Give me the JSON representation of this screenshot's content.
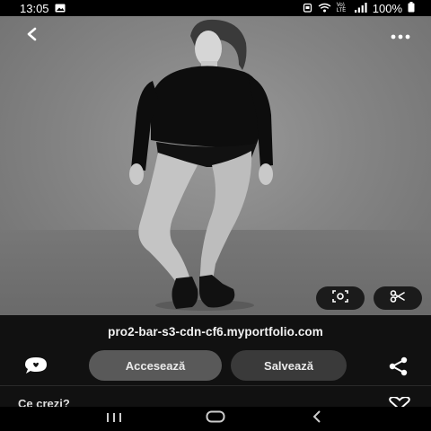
{
  "status_bar": {
    "time": "13:05",
    "signal_label": "Vo) LTE",
    "battery_percent": "100%"
  },
  "source": {
    "url": "pro2-bar-s3-cdn-cf6.myportfolio.com"
  },
  "actions": {
    "visit_label": "Accesează",
    "save_label": "Salvează"
  },
  "comments": {
    "prompt": "Ce crezi?"
  },
  "icons": {
    "back": "back-arrow-icon",
    "more": "more-options-icon",
    "lens": "visual-search-icon",
    "crop": "scissors-icon",
    "chat": "chat-bubble-icon",
    "share": "share-icon",
    "heart": "heart-icon"
  }
}
